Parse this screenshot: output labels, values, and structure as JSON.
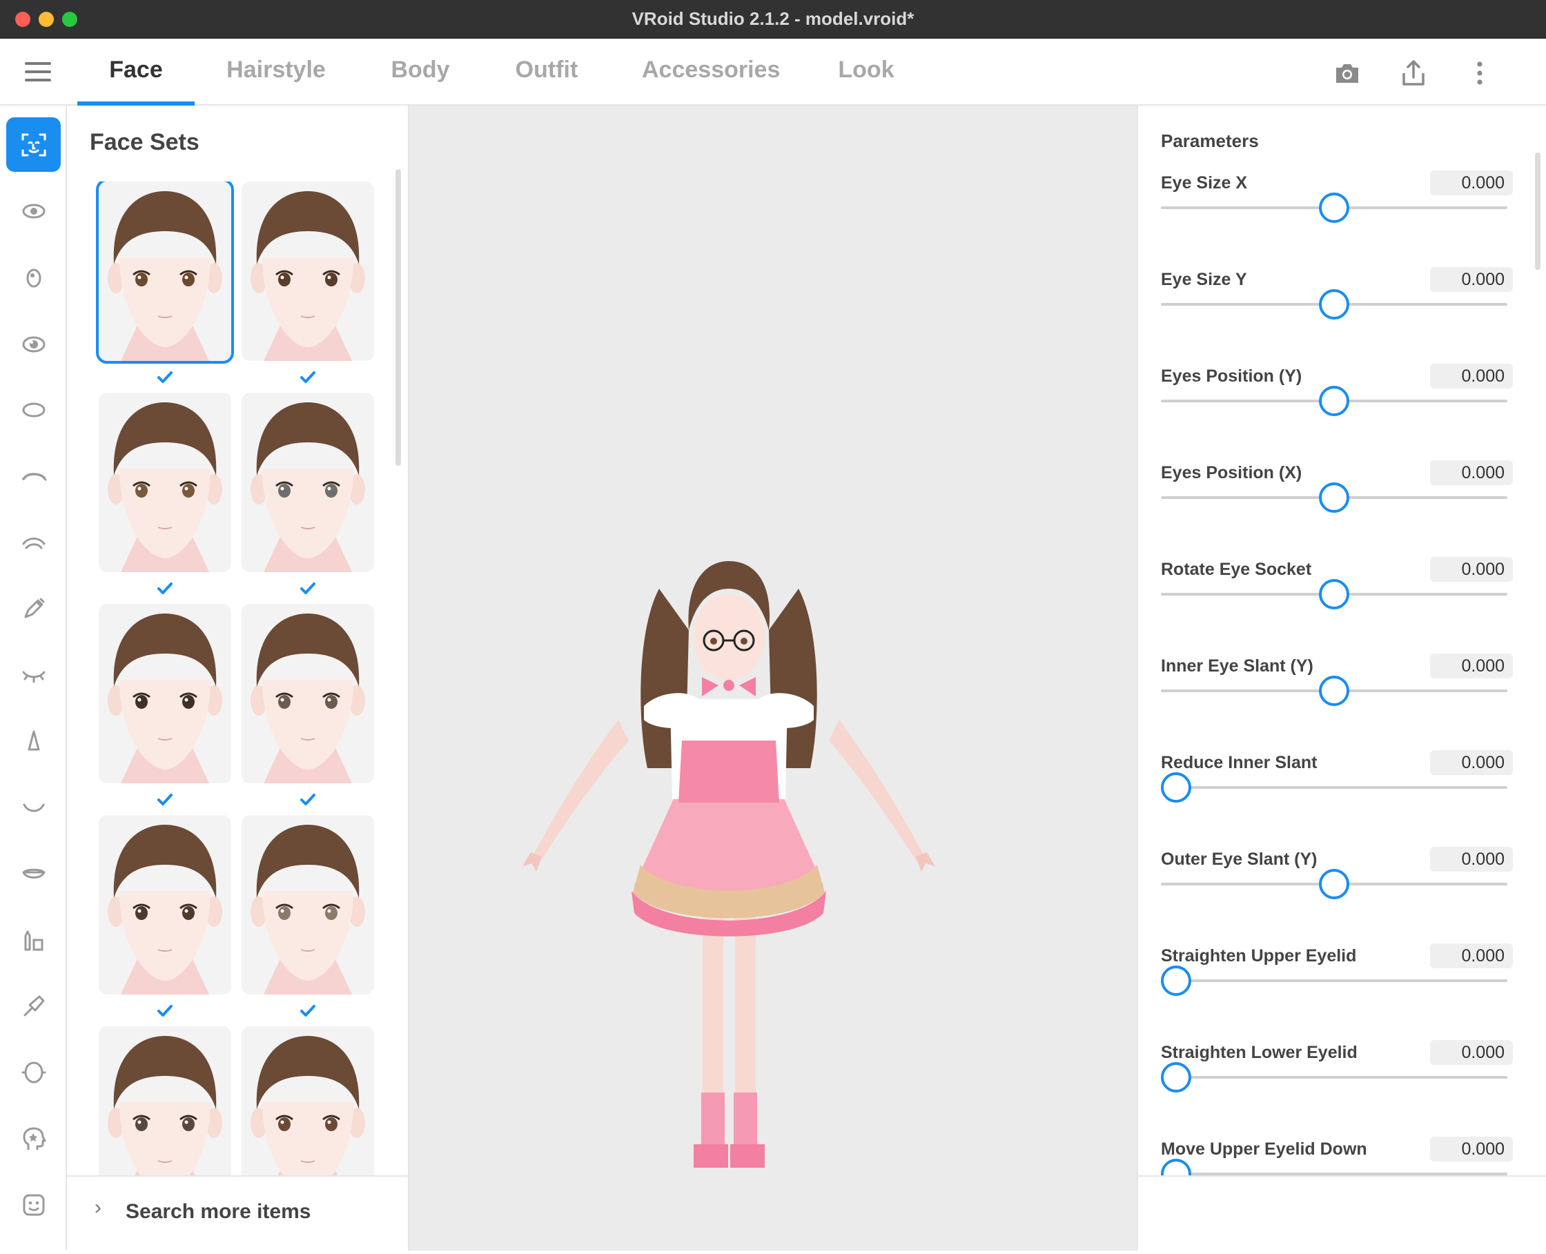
{
  "window": {
    "title": "VRoid Studio 2.1.2 - model.vroid*"
  },
  "topnav": {
    "tabs": [
      {
        "label": "Face",
        "active": true
      },
      {
        "label": "Hairstyle",
        "active": false
      },
      {
        "label": "Body",
        "active": false
      },
      {
        "label": "Outfit",
        "active": false
      },
      {
        "label": "Accessories",
        "active": false
      },
      {
        "label": "Look",
        "active": false
      }
    ],
    "actions": [
      "camera-icon",
      "share-icon",
      "more-vertical-icon"
    ]
  },
  "rail": {
    "items": [
      {
        "icon": "face-set-icon",
        "active": true
      },
      {
        "icon": "eye-icon",
        "active": false
      },
      {
        "icon": "iris-icon",
        "active": false
      },
      {
        "icon": "eye-highlight-icon",
        "active": false
      },
      {
        "icon": "eye-white-icon",
        "active": false
      },
      {
        "icon": "eyeline-icon",
        "active": false
      },
      {
        "icon": "eyelash-icon",
        "active": false
      },
      {
        "icon": "eyeliner-pen-icon",
        "active": false
      },
      {
        "icon": "closed-eye-icon",
        "active": false
      },
      {
        "icon": "nose-icon",
        "active": false
      },
      {
        "icon": "mouth-icon",
        "active": false
      },
      {
        "icon": "lips-icon",
        "active": false
      },
      {
        "icon": "makeup-icon",
        "active": false
      },
      {
        "icon": "brush-icon",
        "active": false
      },
      {
        "icon": "face-shape-icon",
        "active": false
      },
      {
        "icon": "head-star-icon",
        "active": false
      },
      {
        "icon": "face-preset-icon",
        "active": false
      }
    ]
  },
  "face_sets": {
    "title": "Face Sets",
    "items": [
      {
        "selected": true,
        "owned": true,
        "variant": "a"
      },
      {
        "selected": false,
        "owned": true,
        "variant": "b"
      },
      {
        "selected": false,
        "owned": true,
        "variant": "c"
      },
      {
        "selected": false,
        "owned": true,
        "variant": "d"
      },
      {
        "selected": false,
        "owned": true,
        "variant": "e"
      },
      {
        "selected": false,
        "owned": true,
        "variant": "f"
      },
      {
        "selected": false,
        "owned": true,
        "variant": "g"
      },
      {
        "selected": false,
        "owned": true,
        "variant": "h"
      },
      {
        "selected": false,
        "owned": false,
        "variant": "i"
      },
      {
        "selected": false,
        "owned": false,
        "variant": "j"
      }
    ],
    "search_more": "Search more items"
  },
  "parameters": {
    "title": "Parameters",
    "items": [
      {
        "label": "Eye Size X",
        "value": "0.000",
        "position": 0.5
      },
      {
        "label": "Eye Size Y",
        "value": "0.000",
        "position": 0.5
      },
      {
        "label": "Eyes Position (Y)",
        "value": "0.000",
        "position": 0.5
      },
      {
        "label": "Eyes Position (X)",
        "value": "0.000",
        "position": 0.5
      },
      {
        "label": "Rotate Eye Socket",
        "value": "0.000",
        "position": 0.5
      },
      {
        "label": "Inner Eye Slant (Y)",
        "value": "0.000",
        "position": 0.5
      },
      {
        "label": "Reduce Inner Slant",
        "value": "0.000",
        "position": 0.0
      },
      {
        "label": "Outer Eye Slant (Y)",
        "value": "0.000",
        "position": 0.5
      },
      {
        "label": "Straighten Upper Eyelid",
        "value": "0.000",
        "position": 0.0
      },
      {
        "label": "Straighten Lower Eyelid",
        "value": "0.000",
        "position": 0.0
      },
      {
        "label": "Move Upper Eyelid Down",
        "value": "0.000",
        "position": 0.0
      }
    ]
  },
  "colors": {
    "accent": "#1a8df0",
    "viewport_bg": "#ebebeb"
  }
}
